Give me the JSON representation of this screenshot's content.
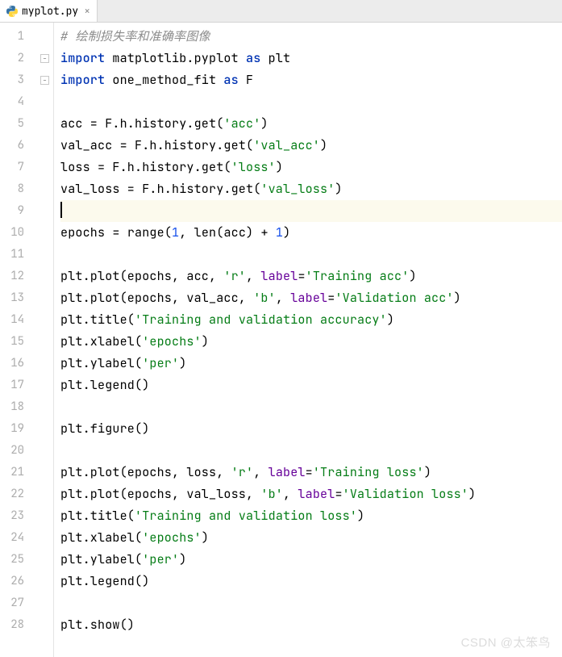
{
  "tab": {
    "filename": "myplot.py",
    "icon": "python-file-icon",
    "close_glyph": "×"
  },
  "editor": {
    "active_line": 9,
    "lines": [
      {
        "n": 1,
        "tokens": [
          {
            "t": "# 绘制损失率和准确率图像",
            "c": "comment"
          }
        ]
      },
      {
        "n": 2,
        "fold": true,
        "tokens": [
          {
            "t": "import",
            "c": "kw"
          },
          {
            "t": " matplotlib.pyplot "
          },
          {
            "t": "as",
            "c": "kw"
          },
          {
            "t": " plt"
          }
        ]
      },
      {
        "n": 3,
        "fold": true,
        "tokens": [
          {
            "t": "import",
            "c": "kw"
          },
          {
            "t": " one_method_fit "
          },
          {
            "t": "as",
            "c": "kw"
          },
          {
            "t": " F"
          }
        ]
      },
      {
        "n": 4,
        "tokens": []
      },
      {
        "n": 5,
        "tokens": [
          {
            "t": "acc = F.h.history.get("
          },
          {
            "t": "'acc'",
            "c": "str"
          },
          {
            "t": ")"
          }
        ]
      },
      {
        "n": 6,
        "tokens": [
          {
            "t": "val_acc = F.h.history.get("
          },
          {
            "t": "'val_acc'",
            "c": "str"
          },
          {
            "t": ")"
          }
        ]
      },
      {
        "n": 7,
        "tokens": [
          {
            "t": "loss = F.h.history.get("
          },
          {
            "t": "'loss'",
            "c": "str"
          },
          {
            "t": ")"
          }
        ]
      },
      {
        "n": 8,
        "tokens": [
          {
            "t": "val_loss = F.h.history.get("
          },
          {
            "t": "'val_loss'",
            "c": "str"
          },
          {
            "t": ")"
          }
        ]
      },
      {
        "n": 9,
        "caret": true,
        "tokens": []
      },
      {
        "n": 10,
        "tokens": [
          {
            "t": "epochs = "
          },
          {
            "t": "range",
            "c": "call"
          },
          {
            "t": "("
          },
          {
            "t": "1",
            "c": "num"
          },
          {
            "t": ", "
          },
          {
            "t": "len",
            "c": "call"
          },
          {
            "t": "(acc) + "
          },
          {
            "t": "1",
            "c": "num"
          },
          {
            "t": ")"
          }
        ]
      },
      {
        "n": 11,
        "tokens": []
      },
      {
        "n": 12,
        "tokens": [
          {
            "t": "plt.plot(epochs, acc, "
          },
          {
            "t": "'r'",
            "c": "str"
          },
          {
            "t": ", "
          },
          {
            "t": "label",
            "c": "param"
          },
          {
            "t": "="
          },
          {
            "t": "'Training acc'",
            "c": "str"
          },
          {
            "t": ")"
          }
        ]
      },
      {
        "n": 13,
        "tokens": [
          {
            "t": "plt.plot(epochs, val_acc, "
          },
          {
            "t": "'b'",
            "c": "str"
          },
          {
            "t": ", "
          },
          {
            "t": "label",
            "c": "param"
          },
          {
            "t": "="
          },
          {
            "t": "'Validation acc'",
            "c": "str"
          },
          {
            "t": ")"
          }
        ]
      },
      {
        "n": 14,
        "tokens": [
          {
            "t": "plt.title("
          },
          {
            "t": "'Training and validation accuracy'",
            "c": "str"
          },
          {
            "t": ")"
          }
        ]
      },
      {
        "n": 15,
        "tokens": [
          {
            "t": "plt.xlabel("
          },
          {
            "t": "'epochs'",
            "c": "str"
          },
          {
            "t": ")"
          }
        ]
      },
      {
        "n": 16,
        "tokens": [
          {
            "t": "plt.ylabel("
          },
          {
            "t": "'per'",
            "c": "str"
          },
          {
            "t": ")"
          }
        ]
      },
      {
        "n": 17,
        "tokens": [
          {
            "t": "plt.legend()"
          }
        ]
      },
      {
        "n": 18,
        "tokens": []
      },
      {
        "n": 19,
        "tokens": [
          {
            "t": "plt.figure()"
          }
        ]
      },
      {
        "n": 20,
        "tokens": []
      },
      {
        "n": 21,
        "tokens": [
          {
            "t": "plt.plot(epochs, loss, "
          },
          {
            "t": "'r'",
            "c": "str"
          },
          {
            "t": ", "
          },
          {
            "t": "label",
            "c": "param"
          },
          {
            "t": "="
          },
          {
            "t": "'Training loss'",
            "c": "str"
          },
          {
            "t": ")"
          }
        ]
      },
      {
        "n": 22,
        "tokens": [
          {
            "t": "plt.plot(epochs, val_loss, "
          },
          {
            "t": "'b'",
            "c": "str"
          },
          {
            "t": ", "
          },
          {
            "t": "label",
            "c": "param"
          },
          {
            "t": "="
          },
          {
            "t": "'Validation loss'",
            "c": "str"
          },
          {
            "t": ")"
          }
        ]
      },
      {
        "n": 23,
        "tokens": [
          {
            "t": "plt.title("
          },
          {
            "t": "'Training and validation loss'",
            "c": "str"
          },
          {
            "t": ")"
          }
        ]
      },
      {
        "n": 24,
        "tokens": [
          {
            "t": "plt.xlabel("
          },
          {
            "t": "'epochs'",
            "c": "str"
          },
          {
            "t": ")"
          }
        ]
      },
      {
        "n": 25,
        "tokens": [
          {
            "t": "plt.ylabel("
          },
          {
            "t": "'per'",
            "c": "str"
          },
          {
            "t": ")"
          }
        ]
      },
      {
        "n": 26,
        "tokens": [
          {
            "t": "plt.legend()"
          }
        ]
      },
      {
        "n": 27,
        "tokens": []
      },
      {
        "n": 28,
        "tokens": [
          {
            "t": "plt.show()"
          }
        ]
      }
    ]
  },
  "watermark": "CSDN @太笨鸟"
}
